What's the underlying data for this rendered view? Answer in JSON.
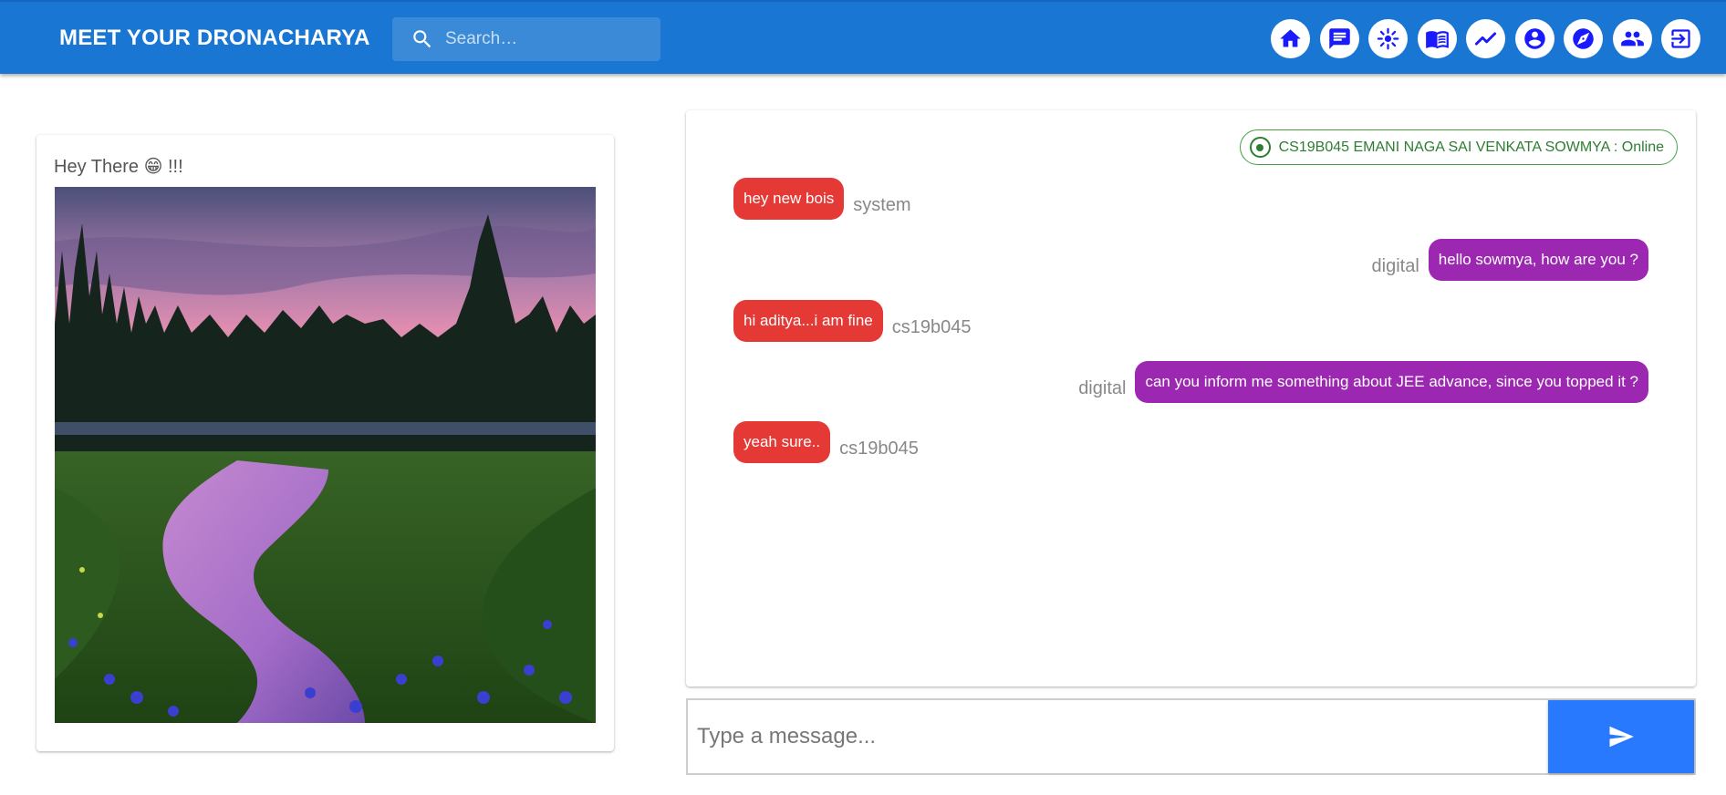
{
  "header": {
    "brand": "MEET YOUR DRONACHARYA",
    "search_placeholder": "Search…",
    "nav_icons": [
      "home-icon",
      "forum-icon",
      "hub-icon",
      "menu-book-icon",
      "trending-up-icon",
      "account-circle-icon",
      "explore-icon",
      "people-icon",
      "logout-icon"
    ]
  },
  "profile_card": {
    "greeting_prefix": "Hey There ",
    "greeting_emoji": "😁",
    "greeting_suffix": " !!!",
    "image_description_icon": "landscape-photo"
  },
  "chat": {
    "status": "CS19B045 EMANI NAGA SAI VENKATA SOWMYA : Online",
    "messages": [
      {
        "side": "left",
        "text": "hey new bois",
        "sender": "system",
        "color": "red"
      },
      {
        "side": "right",
        "text": "hello sowmya, how are you ?",
        "sender": "digital",
        "color": "purple"
      },
      {
        "side": "left",
        "text": "hi aditya...i am fine",
        "sender": "cs19b045",
        "color": "red"
      },
      {
        "side": "right",
        "text": "can you inform me something about JEE advance, since you topped it ?",
        "sender": "digital",
        "color": "purple"
      },
      {
        "side": "left",
        "text": "yeah sure..",
        "sender": "cs19b045",
        "color": "red"
      }
    ],
    "composer_placeholder": "Type a message..."
  },
  "colors": {
    "appbar": "#1976d2",
    "bubble_red": "#e53935",
    "bubble_purple": "#9c27b0",
    "send_button": "#2979ff",
    "online": "#2e7d32",
    "nav_icon": "#1a1aff"
  }
}
